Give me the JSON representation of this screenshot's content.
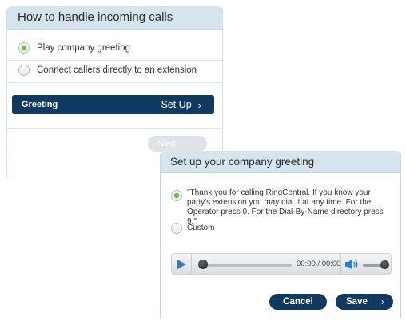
{
  "incoming": {
    "title": "How to handle incoming calls",
    "options": [
      {
        "label": "Play company greeting",
        "selected": true
      },
      {
        "label": "Connect callers directly to an extension",
        "selected": false
      }
    ],
    "greeting_label": "Greeting",
    "setup_label": "Set Up",
    "next_label": "Next"
  },
  "greeting": {
    "title": "Set up your company greeting",
    "options": [
      {
        "label": "\"Thank you for calling RingCentral. If you know your party's extension you may dial it at any time. For the Operator press 0. For the Dial-By-Name directory press 9.\"",
        "selected": true
      },
      {
        "label": "Custom",
        "selected": false
      }
    ],
    "player": {
      "time": "00:00 / 00:00",
      "progress": 0,
      "volume": 1
    },
    "cancel_label": "Cancel",
    "save_label": "Save"
  },
  "icons": {
    "chevron": "chevron-right-icon",
    "play": "play-icon",
    "volume": "speaker-icon"
  },
  "colors": {
    "navy": "#10395f",
    "header_bg": "#d6e4ee",
    "radio_selected": "#6ec341",
    "play_blue": "#2d7ccb"
  }
}
